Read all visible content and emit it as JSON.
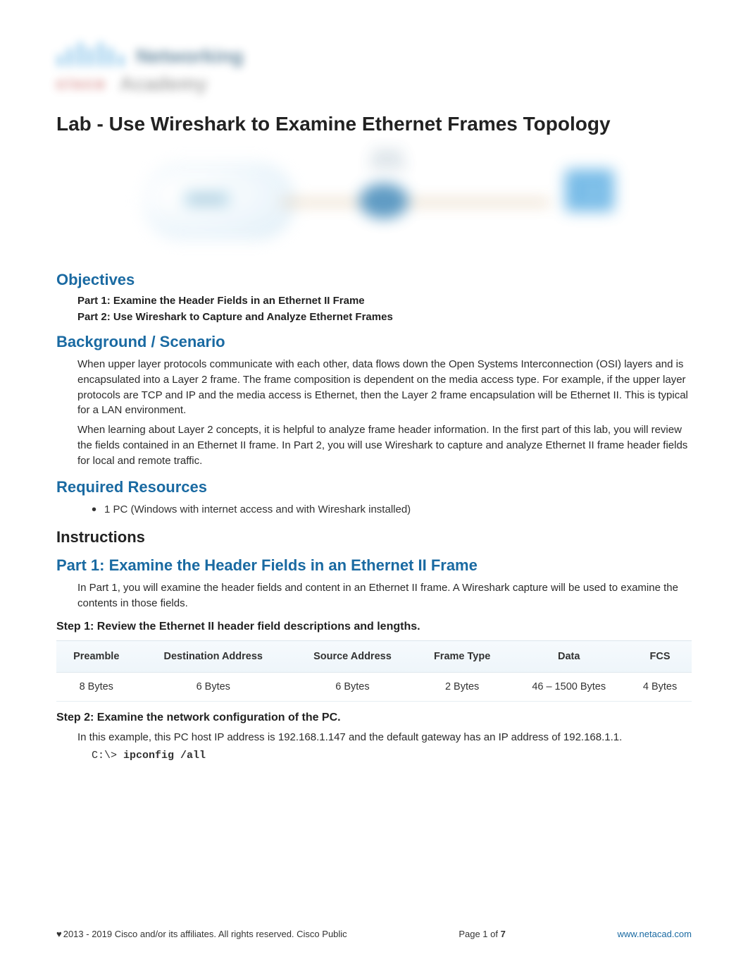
{
  "logo": {
    "brand_sub": "cisco",
    "line1_word": "Networking",
    "line2_word": "Academy"
  },
  "title": "Lab - Use Wireshark to Examine Ethernet Frames Topology",
  "topology": {
    "cloud_label": "Internet",
    "router_label": "Default Gateway",
    "pc_label": "PC"
  },
  "sections": {
    "objectives": {
      "heading": "Objectives",
      "items": [
        "Part 1: Examine the Header Fields in an Ethernet II Frame",
        "Part 2: Use Wireshark to Capture and Analyze Ethernet Frames"
      ]
    },
    "background": {
      "heading": "Background / Scenario",
      "p1": "When upper layer protocols communicate with each other, data flows down the Open Systems Interconnection (OSI) layers and is encapsulated into a Layer 2 frame. The frame composition is dependent on the media access type. For example, if the upper layer protocols are TCP and IP and the media access is Ethernet, then the Layer 2 frame encapsulation will be Ethernet II. This is typical for a LAN environment.",
      "p2": "When learning about Layer 2 concepts, it is helpful to analyze frame header information. In the first part of this lab, you will review the fields contained in an Ethernet II frame. In Part 2, you will use Wireshark to capture and analyze Ethernet II frame header fields for local and remote traffic."
    },
    "resources": {
      "heading": "Required Resources",
      "items": [
        "1 PC (Windows with internet access and with Wireshark installed)"
      ]
    },
    "instructions": {
      "heading": "Instructions"
    },
    "part1": {
      "heading": "Part 1: Examine the Header Fields in an Ethernet II Frame",
      "intro": "In Part 1, you will examine the header fields and content in an Ethernet II frame. A Wireshark capture will be used to examine the contents in those fields."
    },
    "step1": {
      "heading": "Step 1: Review the Ethernet II header field descriptions and lengths.",
      "table": {
        "headers": [
          "Preamble",
          "Destination Address",
          "Source Address",
          "Frame Type",
          "Data",
          "FCS"
        ],
        "row": [
          "8 Bytes",
          "6 Bytes",
          "6 Bytes",
          "2 Bytes",
          "46 – 1500 Bytes",
          "4 Bytes"
        ]
      }
    },
    "step2": {
      "heading": "Step 2: Examine the network configuration of the PC.",
      "p": "In this example, this PC host IP address is 192.168.1.147 and the default gateway has an IP address of 192.168.1.1.",
      "code_prompt": "C:\\> ",
      "code_cmd": "ipconfig /all"
    }
  },
  "footer": {
    "left": "2013 - 2019 Cisco and/or its affiliates. All rights reserved. Cisco Public",
    "center_prefix": "Page 1 of ",
    "center_total": "7",
    "right_url": "www.netacad.com"
  },
  "chart_data": {
    "type": "table",
    "title": "Ethernet II header field descriptions and lengths",
    "columns": [
      "Preamble",
      "Destination Address",
      "Source Address",
      "Frame Type",
      "Data",
      "FCS"
    ],
    "rows": [
      [
        "8 Bytes",
        "6 Bytes",
        "6 Bytes",
        "2 Bytes",
        "46 – 1500 Bytes",
        "4 Bytes"
      ]
    ]
  }
}
